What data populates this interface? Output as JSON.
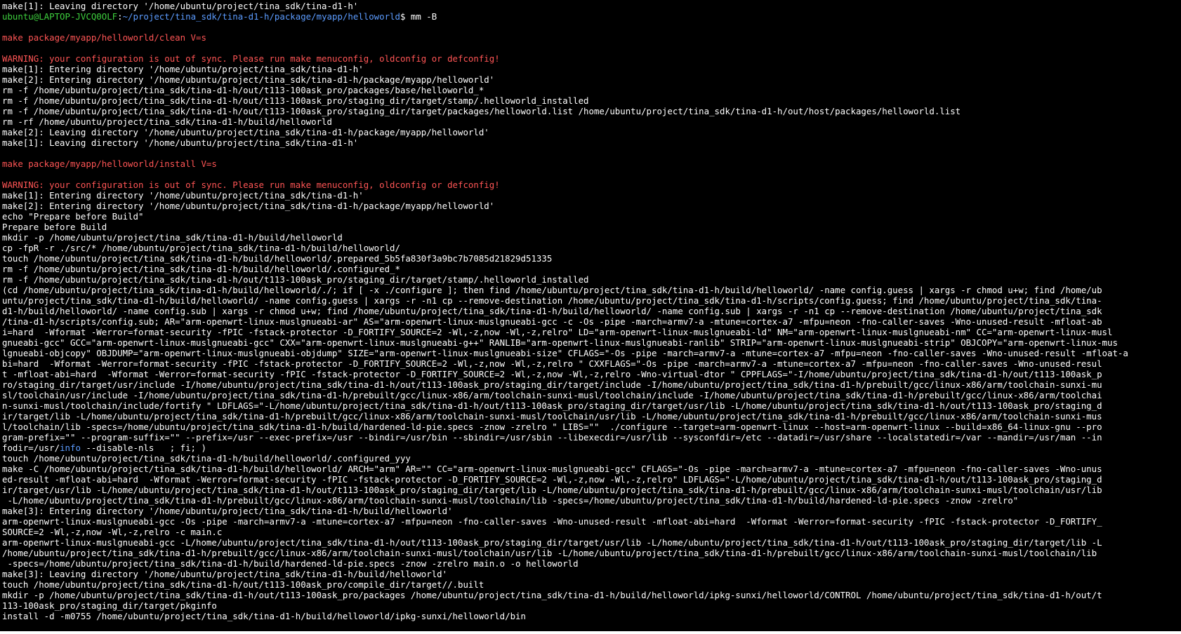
{
  "colors": {
    "background": "#000000",
    "text": "#ffffff",
    "prompt_user": "#3ed03e",
    "prompt_path": "#5c9cff",
    "warning": "#ff5555",
    "info_keyword": "#5c9cff"
  },
  "terminal": {
    "prompt": {
      "user_host": "ubuntu@LAPTOP-JVCQ0OLF",
      "separator": ":",
      "path": "~/project/tina_sdk/tina-d1-h/package/myapp/helloworld",
      "symbol": "$",
      "command": " mm -B"
    },
    "lines": [
      {
        "type": "normal",
        "text": "make[1]: Leaving directory '/home/ubuntu/project/tina_sdk/tina-d1-h'"
      },
      {
        "type": "prompt"
      },
      {
        "type": "blank",
        "text": ""
      },
      {
        "type": "header",
        "text": "make package/myapp/helloworld/clean V=s"
      },
      {
        "type": "blank",
        "text": ""
      },
      {
        "type": "warning",
        "text": "WARNING: your configuration is out of sync. Please run make menuconfig, oldconfig or defconfig!"
      },
      {
        "type": "normal",
        "text": "make[1]: Entering directory '/home/ubuntu/project/tina_sdk/tina-d1-h'"
      },
      {
        "type": "normal",
        "text": "make[2]: Entering directory '/home/ubuntu/project/tina_sdk/tina-d1-h/package/myapp/helloworld'"
      },
      {
        "type": "normal",
        "text": "rm -f /home/ubuntu/project/tina_sdk/tina-d1-h/out/t113-100ask_pro/packages/base/helloworld_*"
      },
      {
        "type": "normal",
        "text": "rm -f /home/ubuntu/project/tina_sdk/tina-d1-h/out/t113-100ask_pro/staging_dir/target/stamp/.helloworld_installed"
      },
      {
        "type": "normal",
        "text": "rm -f /home/ubuntu/project/tina_sdk/tina-d1-h/out/t113-100ask_pro/staging_dir/target/packages/helloworld.list /home/ubuntu/project/tina_sdk/tina-d1-h/out/host/packages/helloworld.list"
      },
      {
        "type": "normal",
        "text": "rm -rf /home/ubuntu/project/tina_sdk/tina-d1-h/build/helloworld"
      },
      {
        "type": "normal",
        "text": "make[2]: Leaving directory '/home/ubuntu/project/tina_sdk/tina-d1-h/package/myapp/helloworld'"
      },
      {
        "type": "normal",
        "text": "make[1]: Leaving directory '/home/ubuntu/project/tina_sdk/tina-d1-h'"
      },
      {
        "type": "blank",
        "text": ""
      },
      {
        "type": "header",
        "text": "make package/myapp/helloworld/install V=s"
      },
      {
        "type": "blank",
        "text": ""
      },
      {
        "type": "warning",
        "text": "WARNING: your configuration is out of sync. Please run make menuconfig, oldconfig or defconfig!"
      },
      {
        "type": "normal",
        "text": "make[1]: Entering directory '/home/ubuntu/project/tina_sdk/tina-d1-h'"
      },
      {
        "type": "normal",
        "text": "make[2]: Entering directory '/home/ubuntu/project/tina_sdk/tina-d1-h/package/myapp/helloworld'"
      },
      {
        "type": "normal",
        "text": "echo \"Prepare before Build\""
      },
      {
        "type": "normal",
        "text": "Prepare before Build"
      },
      {
        "type": "normal",
        "text": "mkdir -p /home/ubuntu/project/tina_sdk/tina-d1-h/build/helloworld"
      },
      {
        "type": "normal",
        "text": "cp -fpR -r ./src/* /home/ubuntu/project/tina_sdk/tina-d1-h/build/helloworld/"
      },
      {
        "type": "normal",
        "text": "touch /home/ubuntu/project/tina_sdk/tina-d1-h/build/helloworld/.prepared_5b5fa830f3a9bc7b7085d21829d51335"
      },
      {
        "type": "normal",
        "text": "rm -f /home/ubuntu/project/tina_sdk/tina-d1-h/build/helloworld/.configured_*"
      },
      {
        "type": "normal",
        "text": "rm -f /home/ubuntu/project/tina_sdk/tina-d1-h/out/t113-100ask_pro/staging_dir/target/stamp/.helloworld_installed"
      },
      {
        "type": "normal",
        "text": "(cd /home/ubuntu/project/tina_sdk/tina-d1-h/build/helloworld/./; if [ -x ./configure ]; then find /home/ubuntu/project/tina_sdk/tina-d1-h/build/helloworld/ -name config.guess | xargs -r chmod u+w; find /home/ub"
      },
      {
        "type": "normal",
        "text": "untu/project/tina_sdk/tina-d1-h/build/helloworld/ -name config.guess | xargs -r -n1 cp --remove-destination /home/ubuntu/project/tina_sdk/tina-d1-h/scripts/config.guess; find /home/ubuntu/project/tina_sdk/tina-"
      },
      {
        "type": "normal",
        "text": "d1-h/build/helloworld/ -name config.sub | xargs -r chmod u+w; find /home/ubuntu/project/tina_sdk/tina-d1-h/build/helloworld/ -name config.sub | xargs -r -n1 cp --remove-destination /home/ubuntu/project/tina_sdk"
      },
      {
        "type": "normal",
        "text": "/tina-d1-h/scripts/config.sub; AR=\"arm-openwrt-linux-muslgnueabi-ar\" AS=\"arm-openwrt-linux-muslgnueabi-gcc -c -Os -pipe -march=armv7-a -mtune=cortex-a7 -mfpu=neon -fno-caller-saves -Wno-unused-result -mfloat-ab"
      },
      {
        "type": "normal",
        "text": "i=hard  -Wformat -Werror=format-security -fPIC -fstack-protector -D_FORTIFY_SOURCE=2 -Wl,-z,now -Wl,-z,relro\" LD=\"arm-openwrt-linux-muslgnueabi-ld\" NM=\"arm-openwrt-linux-muslgnueabi-nm\" CC=\"arm-openwrt-linux-musl"
      },
      {
        "type": "normal",
        "text": "gnueabi-gcc\" GCC=\"arm-openwrt-linux-muslgnueabi-gcc\" CXX=\"arm-openwrt-linux-muslgnueabi-g++\" RANLIB=\"arm-openwrt-linux-muslgnueabi-ranlib\" STRIP=\"arm-openwrt-linux-muslgnueabi-strip\" OBJCOPY=\"arm-openwrt-linux-mus"
      },
      {
        "type": "normal",
        "text": "lgnueabi-objcopy\" OBJDUMP=\"arm-openwrt-linux-muslgnueabi-objdump\" SIZE=\"arm-openwrt-linux-muslgnueabi-size\" CFLAGS=\"-Os -pipe -march=armv7-a -mtune=cortex-a7 -mfpu=neon -fno-caller-saves -Wno-unused-result -mfloat-a"
      },
      {
        "type": "normal",
        "text": "bi=hard  -Wformat -Werror=format-security -fPIC -fstack-protector -D_FORTIFY_SOURCE=2 -Wl,-z,now -Wl,-z,relro \" CXXFLAGS=\"-Os -pipe -march=armv7-a -mtune=cortex-a7 -mfpu=neon -fno-caller-saves -Wno-unused-resul"
      },
      {
        "type": "normal",
        "text": "t -mfloat-abi=hard  -Wformat -Werror=format-security -fPIC -fstack-protector -D_FORTIFY_SOURCE=2 -Wl,-z,now -Wl,-z,relro -Wno-virtual-dtor \" CPPFLAGS=\"-I/home/ubuntu/project/tina_sdk/tina-d1-h/out/t113-100ask_p"
      },
      {
        "type": "normal",
        "text": "ro/staging_dir/target/usr/include -I/home/ubuntu/project/tina_sdk/tina-d1-h/out/t113-100ask_pro/staging_dir/target/include -I/home/ubuntu/project/tina_sdk/tina-d1-h/prebuilt/gcc/linux-x86/arm/toolchain-sunxi-mu"
      },
      {
        "type": "normal",
        "text": "sl/toolchain/usr/include -I/home/ubuntu/project/tina_sdk/tina-d1-h/prebuilt/gcc/linux-x86/arm/toolchain-sunxi-musl/toolchain/include -I/home/ubuntu/project/tina_sdk/tina-d1-h/prebuilt/gcc/linux-x86/arm/toolchai"
      },
      {
        "type": "normal",
        "text": "n-sunxi-musl/toolchain/include/fortify \" LDFLAGS=\"-L/home/ubuntu/project/tina_sdk/tina-d1-h/out/t113-100ask_pro/staging_dir/target/usr/lib -L/home/ubuntu/project/tina_sdk/tina-d1-h/out/t113-100ask_pro/staging_d"
      },
      {
        "type": "normal",
        "text": "ir/target/lib -L/home/ubuntu/project/tina_sdk/tina-d1-h/prebuilt/gcc/linux-x86/arm/toolchain-sunxi-musl/toolchain/usr/lib -L/home/ubuntu/project/tina_sdk/tina-d1-h/prebuilt/gcc/linux-x86/arm/toolchain-sunxi-mus"
      },
      {
        "type": "normal",
        "text": "l/toolchain/lib -specs=/home/ubuntu/project/tina_sdk/tina-d1-h/build/hardened-ld-pie.specs -znow -zrelro \" LIBS=\"\"  ./configure --target=arm-openwrt-linux --host=arm-openwrt-linux --build=x86_64-linux-gnu --pro"
      },
      {
        "type": "normal",
        "text": "gram-prefix=\"\" --program-suffix=\"\" --prefix=/usr --exec-prefix=/usr --bindir=/usr/bin --sbindir=/usr/sbin --libexecdir=/usr/lib --sysconfdir=/etc --datadir=/usr/share --localstatedir=/var --mandir=/usr/man --in"
      },
      {
        "type": "info",
        "before": "fodir=/usr/",
        "keyword": "info",
        "after": " --disable-nls   ; fi; )"
      },
      {
        "type": "normal",
        "text": "touch /home/ubuntu/project/tina_sdk/tina-d1-h/build/helloworld/.configured_yyy"
      },
      {
        "type": "normal",
        "text": "make -C /home/ubuntu/project/tina_sdk/tina-d1-h/build/helloworld/ ARCH=\"arm\" AR=\"\" CC=\"arm-openwrt-linux-muslgnueabi-gcc\" CFLAGS=\"-Os -pipe -march=armv7-a -mtune=cortex-a7 -mfpu=neon -fno-caller-saves -Wno-unus"
      },
      {
        "type": "normal",
        "text": "ed-result -mfloat-abi=hard  -Wformat -Werror=format-security -fPIC -fstack-protector -D_FORTIFY_SOURCE=2 -Wl,-z,now -Wl,-z,relro\" LDFLAGS=\"-L/home/ubuntu/project/tina_sdk/tina-d1-h/out/t113-100ask_pro/staging_d"
      },
      {
        "type": "normal",
        "text": "ir/target/usr/lib -L/home/ubuntu/project/tina_sdk/tina-d1-h/out/t113-100ask_pro/staging_dir/target/lib -L/home/ubuntu/project/tina_sdk/tina-d1-h/prebuilt/gcc/linux-x86/arm/toolchain-sunxi-musl/toolchain/usr/lib"
      },
      {
        "type": "normal",
        "text": " -L/home/ubuntu/project/tina_sdk/tina-d1-h/prebuilt/gcc/linux-x86/arm/toolchain-sunxi-musl/toolchain/lib -specs=/home/ubuntu/project/tina_sdk/tina-d1-h/build/hardened-ld-pie.specs -znow -zrelro\""
      },
      {
        "type": "normal",
        "text": "make[3]: Entering directory '/home/ubuntu/project/tina_sdk/tina-d1-h/build/helloworld'"
      },
      {
        "type": "normal",
        "text": "arm-openwrt-linux-muslgnueabi-gcc -Os -pipe -march=armv7-a -mtune=cortex-a7 -mfpu=neon -fno-caller-saves -Wno-unused-result -mfloat-abi=hard  -Wformat -Werror=format-security -fPIC -fstack-protector -D_FORTIFY_"
      },
      {
        "type": "normal",
        "text": "SOURCE=2 -Wl,-z,now -Wl,-z,relro -c main.c"
      },
      {
        "type": "normal",
        "text": "arm-openwrt-linux-muslgnueabi-gcc -L/home/ubuntu/project/tina_sdk/tina-d1-h/out/t113-100ask_pro/staging_dir/target/usr/lib -L/home/ubuntu/project/tina_sdk/tina-d1-h/out/t113-100ask_pro/staging_dir/target/lib -L"
      },
      {
        "type": "normal",
        "text": "/home/ubuntu/project/tina_sdk/tina-d1-h/prebuilt/gcc/linux-x86/arm/toolchain-sunxi-musl/toolchain/usr/lib -L/home/ubuntu/project/tina_sdk/tina-d1-h/prebuilt/gcc/linux-x86/arm/toolchain-sunxi-musl/toolchain/lib"
      },
      {
        "type": "normal",
        "text": " -specs=/home/ubuntu/project/tina_sdk/tina-d1-h/build/hardened-ld-pie.specs -znow -zrelro main.o -o helloworld"
      },
      {
        "type": "normal",
        "text": "make[3]: Leaving directory '/home/ubuntu/project/tina_sdk/tina-d1-h/build/helloworld'"
      },
      {
        "type": "normal",
        "text": "touch /home/ubuntu/project/tina_sdk/tina-d1-h/out/t113-100ask_pro/compile_dir/target//.built"
      },
      {
        "type": "normal",
        "text": "mkdir -p /home/ubuntu/project/tina_sdk/tina-d1-h/out/t113-100ask_pro/packages /home/ubuntu/project/tina_sdk/tina-d1-h/build/helloworld/ipkg-sunxi/helloworld/CONTROL /home/ubuntu/project/tina_sdk/tina-d1-h/out/t"
      },
      {
        "type": "normal",
        "text": "113-100ask_pro/staging_dir/target/pkginfo"
      },
      {
        "type": "normal",
        "text": "install -d -m0755 /home/ubuntu/project/tina_sdk/tina-d1-h/build/helloworld/ipkg-sunxi/helloworld/bin"
      }
    ]
  }
}
